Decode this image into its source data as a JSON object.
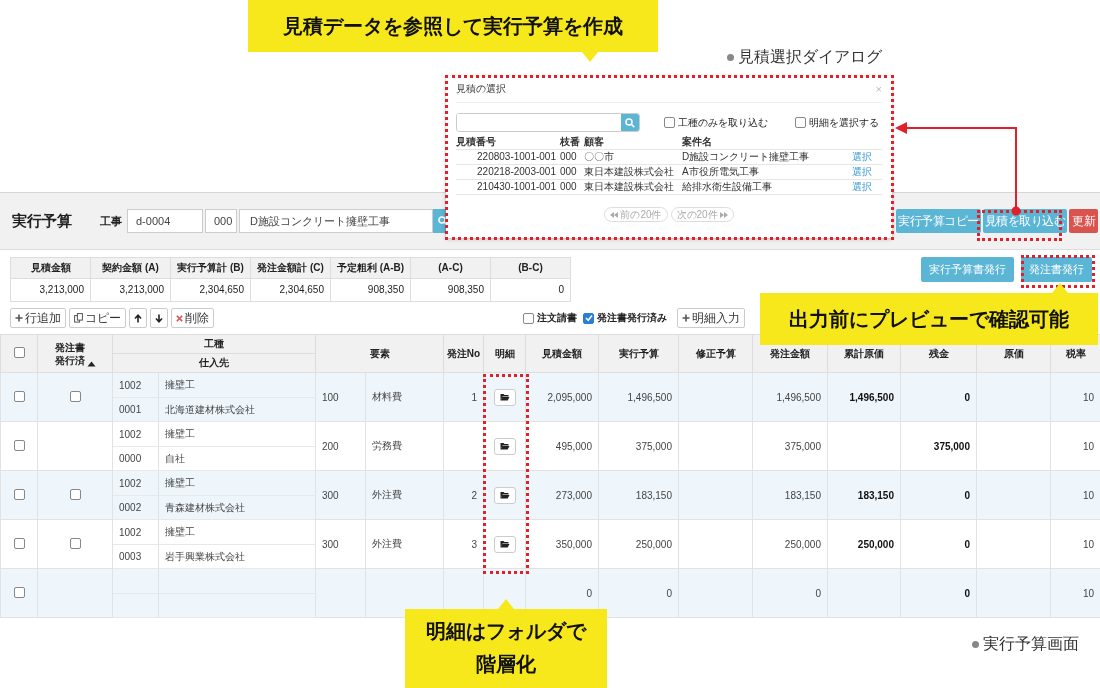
{
  "callouts": [
    {
      "text": "見積データを参照して実行予算を作成"
    },
    {
      "text": "出力前にプレビューで確認可能"
    },
    {
      "text": "明細はフォルダで階層化"
    }
  ],
  "annotations": [
    {
      "text": "見積選択ダイアログ"
    },
    {
      "text": "実行予算画面"
    }
  ],
  "header": {
    "title": "実行予算",
    "project_label": "工事",
    "project_code": "d-0004",
    "branch": "000",
    "project_name": "D施設コンクリート擁壁工事",
    "buttons": [
      {
        "label": "実行予算コピー",
        "kind": "primary"
      },
      {
        "label": "見積を取り込む",
        "kind": "primary"
      },
      {
        "label": "更新",
        "kind": "danger"
      }
    ]
  },
  "summary": {
    "columns": [
      "見積金額",
      "契約金額 (A)",
      "実行予算計 (B)",
      "発注金額計 (C)",
      "予定粗利 (A-B)",
      "(A-C)",
      "(B-C)"
    ],
    "values": [
      "3,213,000",
      "3,213,000",
      "2,304,650",
      "2,304,650",
      "908,350",
      "908,350",
      "0"
    ]
  },
  "output_buttons": [
    "実行予算書発行",
    "発注書発行"
  ],
  "toolbar": {
    "buttons": [
      {
        "label": "行追加",
        "kind": "add"
      },
      {
        "label": "コピー",
        "kind": "copy"
      },
      {
        "kind": "up"
      },
      {
        "kind": "down"
      },
      {
        "label": "削除",
        "kind": "delete"
      }
    ],
    "filters": [
      {
        "label": "注文請書",
        "checked": false
      },
      {
        "label": "発注書発行済み",
        "checked": true
      }
    ],
    "detail_button": "明細入力"
  },
  "table": {
    "select_all_checked": false,
    "issued": "発注書発行済",
    "work_type": "工種",
    "supplier": "仕入先",
    "element": "要素",
    "order_no": "発注No",
    "detail": "明細",
    "amount_columns": [
      "見積金額",
      "実行予算",
      "修正予算",
      "発注金額",
      "累計原価",
      "残金",
      "原価",
      "税率"
    ],
    "rows": [
      {
        "checked": false,
        "issued_checked": false,
        "work_code": "1002",
        "work_name": "擁壁工",
        "supplier_code": "0001",
        "supplier_name": "北海道建材株式会社",
        "element_code": "100",
        "element_name": "材料費",
        "order_no": "1",
        "has_detail": true,
        "estimate": "2,095,000",
        "budget": "1,496,500",
        "order_amount": "1,496,500",
        "cumulative_cost": "1,496,500",
        "balance": "0",
        "tax_rate": "10"
      },
      {
        "checked": false,
        "work_code": "1002",
        "work_name": "擁壁工",
        "supplier_code": "0000",
        "supplier_name": "自社",
        "element_code": "200",
        "element_name": "労務費",
        "has_detail": true,
        "estimate": "495,000",
        "budget": "375,000",
        "order_amount": "375,000",
        "balance": "375,000",
        "tax_rate": "10"
      },
      {
        "checked": false,
        "issued_checked": false,
        "work_code": "1002",
        "work_name": "擁壁工",
        "supplier_code": "0002",
        "supplier_name": "青森建材株式会社",
        "element_code": "300",
        "element_name": "外注費",
        "order_no": "2",
        "has_detail": true,
        "estimate": "273,000",
        "budget": "183,150",
        "order_amount": "183,150",
        "cumulative_cost": "183,150",
        "balance": "0",
        "tax_rate": "10"
      },
      {
        "checked": false,
        "issued_checked": false,
        "work_code": "1002",
        "work_name": "擁壁工",
        "supplier_code": "0003",
        "supplier_name": "岩手興業株式会社",
        "element_code": "300",
        "element_name": "外注費",
        "order_no": "3",
        "has_detail": true,
        "estimate": "350,000",
        "budget": "250,000",
        "order_amount": "250,000",
        "cumulative_cost": "250,000",
        "balance": "0",
        "tax_rate": "10"
      },
      {
        "checked": false,
        "estimate": "0",
        "budget": "0",
        "order_amount": "0",
        "balance": "0",
        "tax_rate": "10"
      }
    ]
  },
  "dialog": {
    "title": "見積の選択",
    "close": "×",
    "options": [
      {
        "label": "工種のみを取り込む",
        "checked": false
      },
      {
        "label": "明細を選択する",
        "checked": false
      }
    ],
    "columns": [
      "見積番号",
      "枝番",
      "顧客",
      "案件名"
    ],
    "rows": [
      {
        "number": "220803-1001-001",
        "branch": "000",
        "customer": "〇〇市",
        "project": "D施設コンクリート擁壁工事",
        "action": "選択"
      },
      {
        "number": "220218-2003-001",
        "branch": "000",
        "customer": "東日本建設株式会社",
        "project": "A市役所電気工事",
        "action": "選択"
      },
      {
        "number": "210430-1001-001",
        "branch": "000",
        "customer": "東日本建設株式会社",
        "project": "給排水衛生設備工事",
        "action": "選択"
      }
    ],
    "pager": [
      "前の20件",
      "次の20件"
    ]
  }
}
